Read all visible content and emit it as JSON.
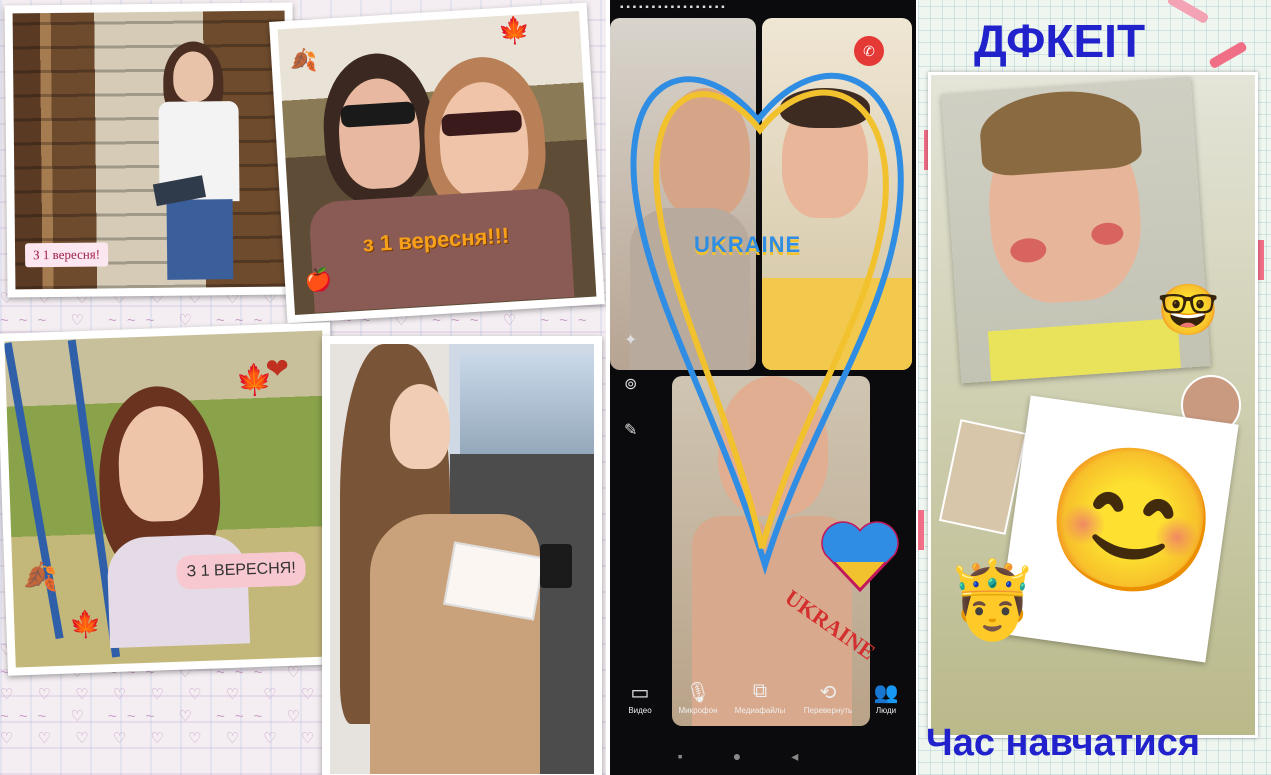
{
  "collage": {
    "caption_small": "З 1 вересня!",
    "caption_autumn": "з 1 вересня!!!",
    "caption_bench": "З 1 ВЕРЕСНЯ!",
    "icons": [
      "book-icon",
      "heart-icon",
      "maple-leaf-icon",
      "apple-icon"
    ]
  },
  "phone": {
    "tile_caption": "UKRAINE",
    "graffiti_text": "UKRAINE",
    "controls": [
      {
        "label": "Видео",
        "icon": "camera-icon",
        "glyph": "▭"
      },
      {
        "label": "Микрофон",
        "icon": "microphone-icon",
        "glyph": "🎙"
      },
      {
        "label": "Медиафайлы",
        "icon": "media-icon",
        "glyph": "⧉"
      },
      {
        "label": "Перевернуть",
        "icon": "flip-camera-icon",
        "glyph": "⟲"
      },
      {
        "label": "Люди",
        "icon": "people-icon",
        "glyph": "👥"
      }
    ],
    "colors": {
      "blue": "#2f8de4",
      "yellow": "#f2c12e",
      "end_call": "#e53935"
    }
  },
  "poster": {
    "title": "ДФКЕІТ",
    "footer": "Час навчатися",
    "emojis": {
      "nerd": "🤓",
      "kiss": "😊",
      "prince": "🤴"
    }
  }
}
